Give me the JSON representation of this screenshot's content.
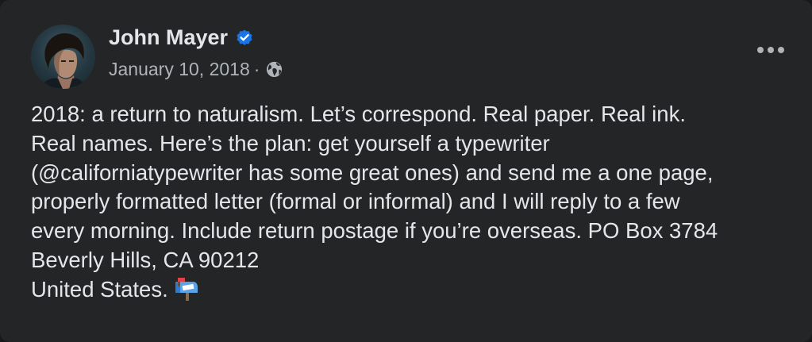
{
  "post": {
    "author": "John Mayer",
    "verified": true,
    "date": "January 10, 2018",
    "meta_separator": "·",
    "audience_icon": "globe-icon",
    "more_icon": "ellipsis-icon",
    "body": "2018: a return to naturalism. Let’s correspond. Real paper. Real ink.\nReal names. Here’s the plan: get yourself a typewriter\n(@californiatypewriter has some great ones) and send me a one page,\nproperly formatted letter (formal or informal) and I will reply to a few\nevery morning. Include return postage if you’re overseas. PO Box 3784\nBeverly Hills, CA  90212\nUnited States.",
    "trailing_emoji_icon": "mailbox-icon"
  },
  "colors": {
    "card_background": "#242526",
    "primary_text": "#e4e6eb",
    "secondary_text": "#b0b3b8",
    "verified_blue": "#1b74e4"
  }
}
